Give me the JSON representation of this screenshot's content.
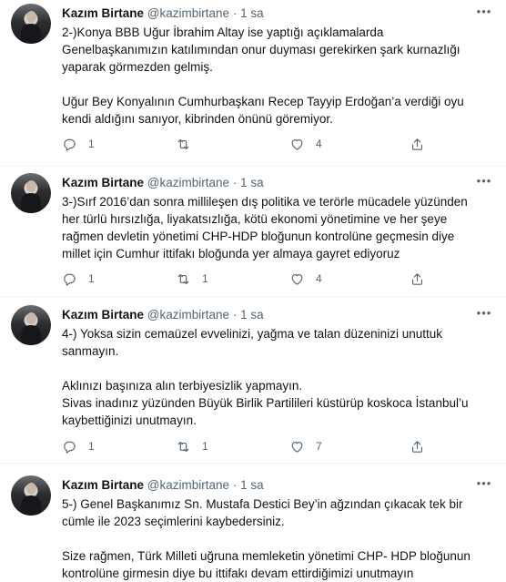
{
  "tweets": [
    {
      "name": "Kazım Birtane",
      "handle": "@kazimbirtane",
      "separator": "·",
      "time": "1 sa",
      "paragraphs": [
        "2-)Konya BBB Uğur İbrahim Altay ise yaptığı açıklamalarda\nGenelbaşkanımızın katılımından onur duyması gerekirken şark kurnazlığı\nyaparak görmezden gelmiş.",
        "Uğur Bey Konyalının Cumhurbaşkanı Recep Tayyip Erdoğan’a verdiği oyu\nkendi aldığını sanıyor, kibrinden önünü göremiyor."
      ],
      "replies": "1",
      "retweets": "",
      "likes": "4"
    },
    {
      "name": "Kazım Birtane",
      "handle": "@kazimbirtane",
      "separator": "·",
      "time": "1 sa",
      "paragraphs": [
        "3-)Sırf 2016’dan sonra millileşen dış politika ve terörle mücadele yüzünden\nher türlü hırsızlığa, liyakatsızlığa, kötü ekonomi yönetimine ve her şeye\nrağmen devletin yönetimi CHP-HDP bloğunun kontrolüne geçmesin diye\nmillet için Cumhur ittifakı bloğunda yer almaya gayret ediyoruz"
      ],
      "replies": "1",
      "retweets": "1",
      "likes": "4"
    },
    {
      "name": "Kazım Birtane",
      "handle": "@kazimbirtane",
      "separator": "·",
      "time": "1 sa",
      "paragraphs": [
        "4-) Yoksa sizin cemaüzel evvelinizi, yağma ve talan düzeninizi unuttuk\nsanmayın.",
        "Aklınızı başınıza alın terbiyesizlik yapmayın.\nSivas inadınız yüzünden Büyük Birlik Partilileri küstürüp koskoca İstanbul’u\nkaybettiğinizi unutmayın."
      ],
      "replies": "1",
      "retweets": "1",
      "likes": "7"
    },
    {
      "name": "Kazım Birtane",
      "handle": "@kazimbirtane",
      "separator": "·",
      "time": "1 sa",
      "paragraphs": [
        "5-) Genel Başkanımız Sn. Mustafa Destici Bey’in ağzından çıkacak tek bir\ncümle ile 2023 seçimlerini kaybedersiniz.",
        "Size rağmen, Türk Milleti uğruna memleketin yönetimi CHP- HDP bloğunun\nkontrolüne girmesin diye bu ittifakı devam ettirdiğimizi unutmayın"
      ],
      "replies": "",
      "retweets": "",
      "likes": ""
    }
  ],
  "icons": {
    "more": "more-horizontal-icon",
    "reply": "reply-icon",
    "retweet": "retweet-icon",
    "like": "heart-icon",
    "share": "share-icon"
  },
  "colors": {
    "text": "#0f1419",
    "secondary": "#536471",
    "divider": "#eff3f4"
  }
}
